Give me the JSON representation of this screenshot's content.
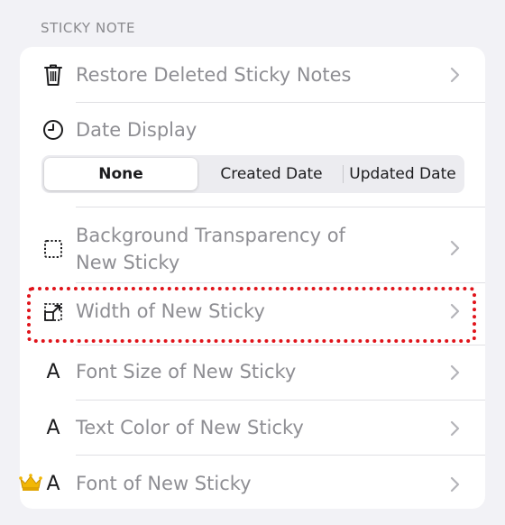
{
  "section": {
    "header": "STICKY NOTE"
  },
  "rows": {
    "restore": {
      "label": "Restore Deleted Sticky Notes",
      "icon": "trash-icon"
    },
    "date_display": {
      "label": "Date Display",
      "icon": "clock-icon"
    },
    "background": {
      "label_line1": "Background Transparency of",
      "label_line2": "New Sticky",
      "icon": "dotted-square-icon"
    },
    "width": {
      "label": "Width of New Sticky",
      "icon": "resize-icon"
    },
    "font_size": {
      "label": "Font Size of New Sticky",
      "icon": "letter-a-icon",
      "glyph": "A"
    },
    "text_color": {
      "label": "Text Color of New Sticky",
      "icon": "letter-a-icon",
      "glyph": "A"
    },
    "font": {
      "label": "Font of New Sticky",
      "icon": "letter-a-icon",
      "glyph": "A",
      "badge": "crown-icon"
    }
  },
  "date_display_options": {
    "none": "None",
    "created": "Created Date",
    "updated": "Updated Date",
    "selected": "None"
  },
  "colors": {
    "highlight": "#e0141b",
    "crown": "#f2b705"
  }
}
